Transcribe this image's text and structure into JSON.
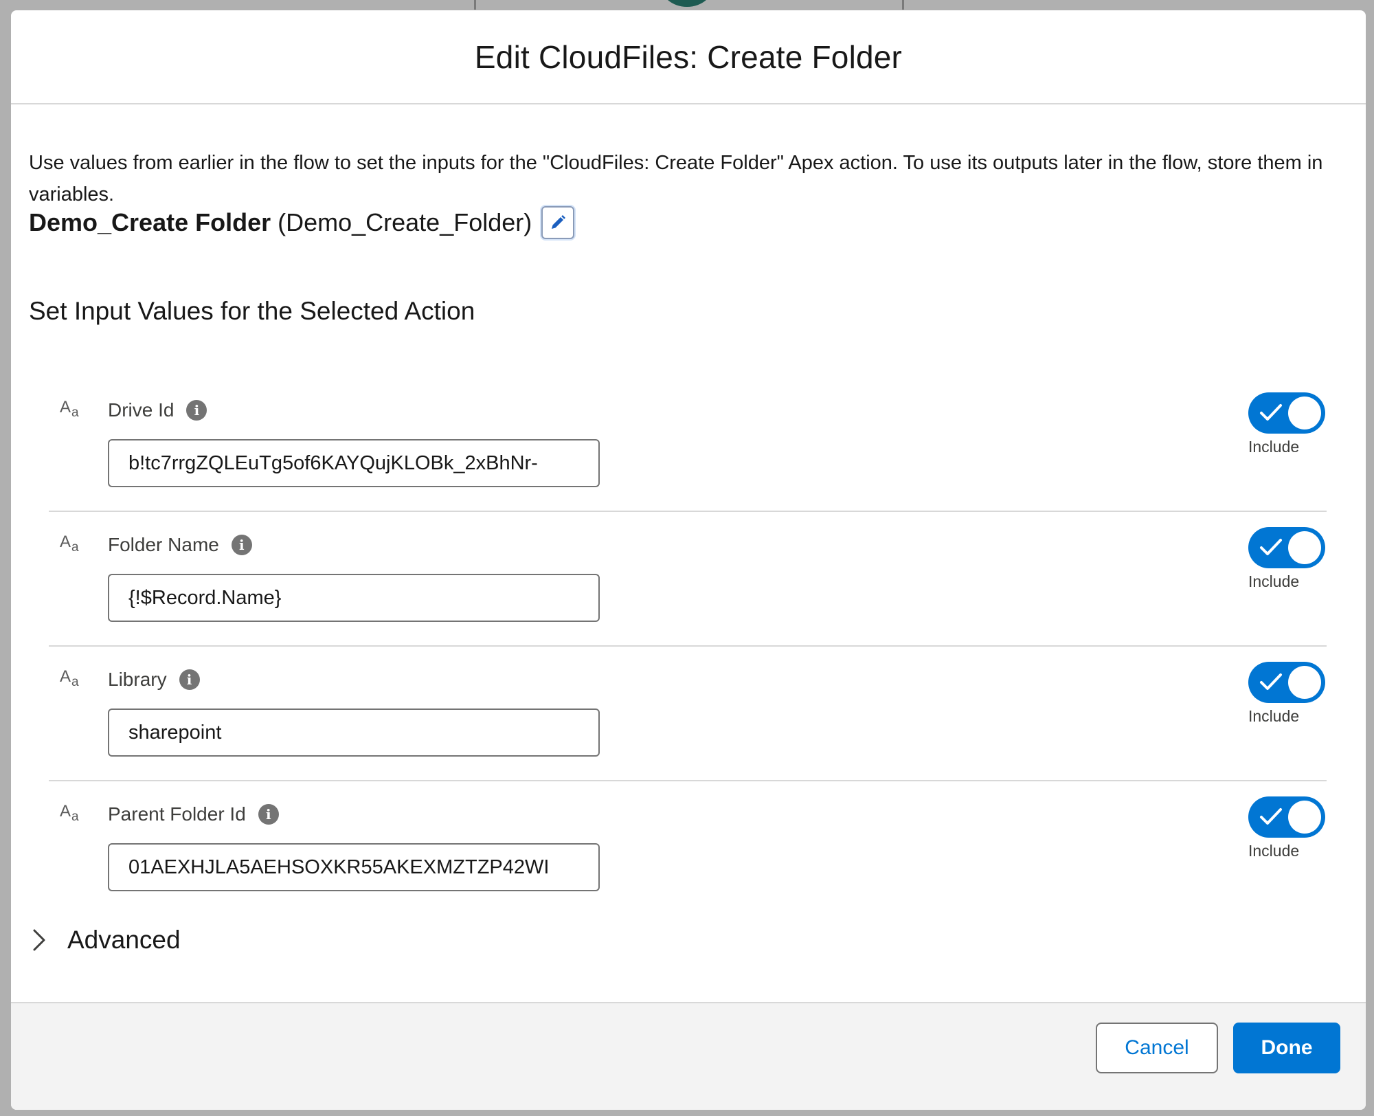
{
  "modal": {
    "title": "Edit CloudFiles: Create Folder",
    "description": "Use values from earlier in the flow to set the inputs for the \"CloudFiles: Create Folder\" Apex action. To use its outputs later in the flow, store them in variables.",
    "action_label": "Demo_Create Folder",
    "action_api_name": "(Demo_Create_Folder)",
    "section_title": "Set Input Values for the Selected Action",
    "type_icon": {
      "top": "A",
      "bottom": "a"
    },
    "info_icon_glyph": "i",
    "params": [
      {
        "label": "Drive Id",
        "value": "b!tc7rrgZQLEuTg5of6KAYQujKLOBk_2xBhNr-",
        "include": true,
        "include_label": "Include"
      },
      {
        "label": "Folder Name",
        "value": "{!$Record.Name}",
        "include": true,
        "include_label": "Include"
      },
      {
        "label": "Library",
        "value": "sharepoint",
        "include": true,
        "include_label": "Include"
      },
      {
        "label": "Parent Folder Id",
        "value": "01AEXHJLA5AEHSOXKR55AKEXMZTZP42WI",
        "include": true,
        "include_label": "Include"
      }
    ],
    "advanced_label": "Advanced",
    "footer": {
      "cancel_label": "Cancel",
      "done_label": "Done"
    }
  },
  "colors": {
    "brand": "#0176d3",
    "backdrop": "#b0b0b0",
    "border": "#747474",
    "divider": "#d8d8d8"
  },
  "icons": {
    "edit": "pencil-icon",
    "info": "info-icon",
    "type": "text-type-icon",
    "toggle_on": "check-icon",
    "advanced": "chevron-right-icon"
  }
}
